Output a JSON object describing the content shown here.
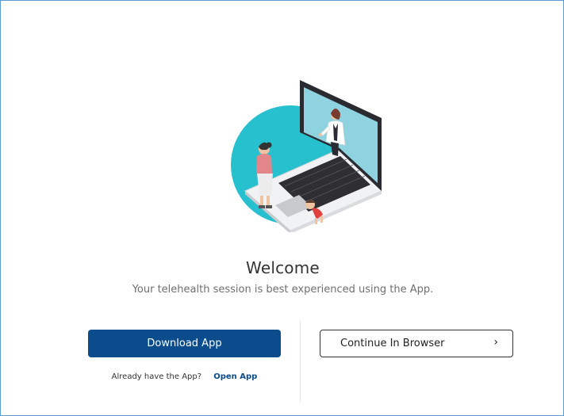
{
  "welcome": {
    "title": "Welcome",
    "subtitle": "Your telehealth session is best experienced using the App."
  },
  "actions": {
    "download_label": "Download App",
    "browser_label": "Continue In Browser",
    "browser_chevron": "›",
    "already_text": "Already have the App?",
    "open_app_label": "Open App"
  },
  "colors": {
    "primary": "#0b4c8c",
    "circle": "#27c0cf",
    "border": "#5b9bd5"
  },
  "icons": {
    "hero": "telehealth-laptop-illustration",
    "chevron": "chevron-right-icon"
  }
}
